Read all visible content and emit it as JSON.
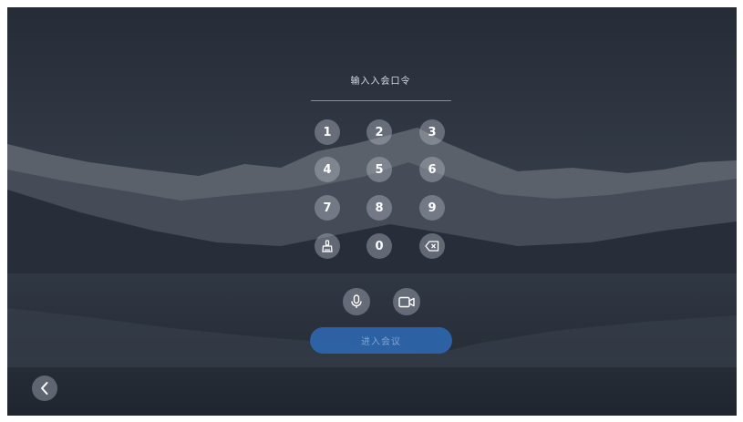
{
  "password": {
    "placeholder": "输入入会口令"
  },
  "keypad": {
    "keys": [
      "1",
      "2",
      "3",
      "4",
      "5",
      "6",
      "7",
      "8",
      "9",
      "0"
    ],
    "clear_icon": "broom-icon",
    "backspace_icon": "backspace-icon"
  },
  "media": {
    "mic_icon": "microphone-icon",
    "camera_icon": "video-camera-icon"
  },
  "join_button": {
    "label": "进入会议",
    "color": "#2d67b0"
  },
  "navigation": {
    "back_icon": "chevron-left-icon"
  }
}
